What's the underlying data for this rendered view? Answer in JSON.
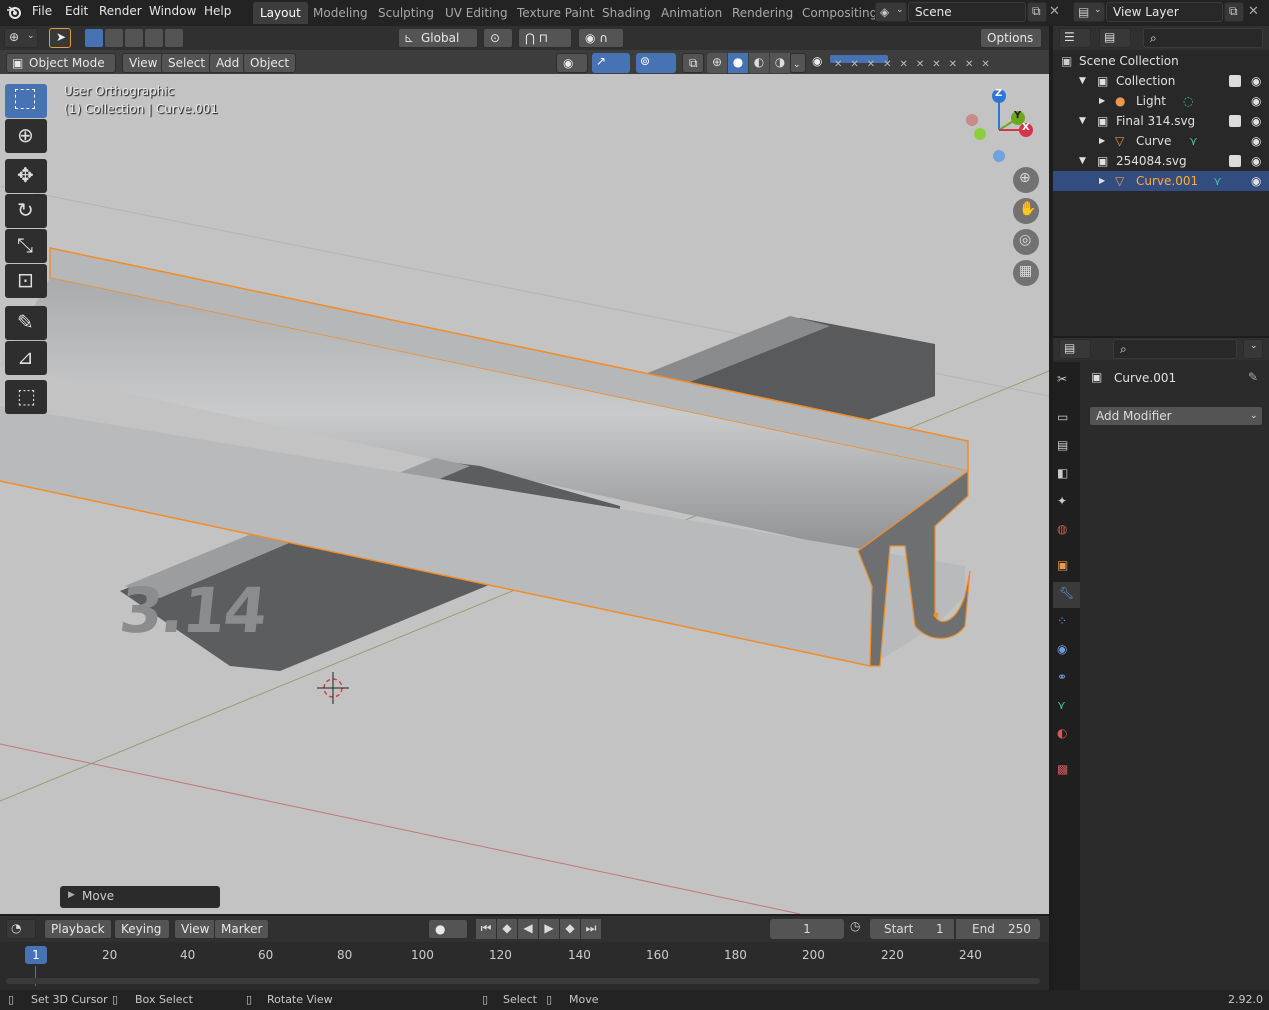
{
  "menubar": {
    "items": [
      "File",
      "Edit",
      "Render",
      "Window",
      "Help"
    ],
    "workspaces": [
      "Layout",
      "Modeling",
      "Sculpting",
      "UV Editing",
      "Texture Paint",
      "Shading",
      "Animation",
      "Rendering",
      "Compositing"
    ],
    "active_workspace": "Layout",
    "scene": "Scene",
    "view_layer": "View Layer"
  },
  "viewport_header": {
    "orientation": "Global",
    "options": "Options",
    "mode": "Object Mode",
    "menus": [
      "View",
      "Select",
      "Add",
      "Object"
    ]
  },
  "viewport": {
    "view_name": "User Orthographic",
    "collection_info": "(1) Collection | Curve.001",
    "last_op": "Move",
    "model_text_1": "3.14",
    "model_text_2": "π",
    "gizmo": {
      "x": "X",
      "y": "Y",
      "z": "Z"
    }
  },
  "toolbar": {
    "tools": [
      "select-box",
      "cursor",
      "move",
      "rotate",
      "scale",
      "transform",
      "annotate",
      "measure",
      "add-cube"
    ],
    "active_tool": "select-box"
  },
  "outliner": {
    "root": "Scene Collection",
    "rows": [
      {
        "label": "Collection",
        "level": 1,
        "type": "collection"
      },
      {
        "label": "Light",
        "level": 2,
        "type": "light"
      },
      {
        "label": "Final 314.svg",
        "level": 1,
        "type": "collection"
      },
      {
        "label": "Curve",
        "level": 2,
        "type": "curve"
      },
      {
        "label": "254084.svg",
        "level": 1,
        "type": "collection"
      },
      {
        "label": "Curve.001",
        "level": 2,
        "type": "curve",
        "selected": true
      }
    ]
  },
  "properties": {
    "object_name": "Curve.001",
    "add_modifier": "Add Modifier"
  },
  "timeline": {
    "menus": [
      "Playback",
      "Keying",
      "View",
      "Marker"
    ],
    "current_frame": "1",
    "start_label": "Start",
    "start": "1",
    "end_label": "End",
    "end": "250",
    "ruler": [
      "20",
      "40",
      "60",
      "80",
      "100",
      "120",
      "140",
      "160",
      "180",
      "200",
      "220",
      "240"
    ],
    "playhead": "1"
  },
  "statusbar": {
    "hints": [
      "Set 3D Cursor",
      "Box Select",
      "Rotate View",
      "Select",
      "Move"
    ],
    "version": "2.92.0"
  },
  "colors": {
    "accent": "#4772b3",
    "selection_outline": "#f28c28",
    "active_text": "#ffaf29"
  }
}
